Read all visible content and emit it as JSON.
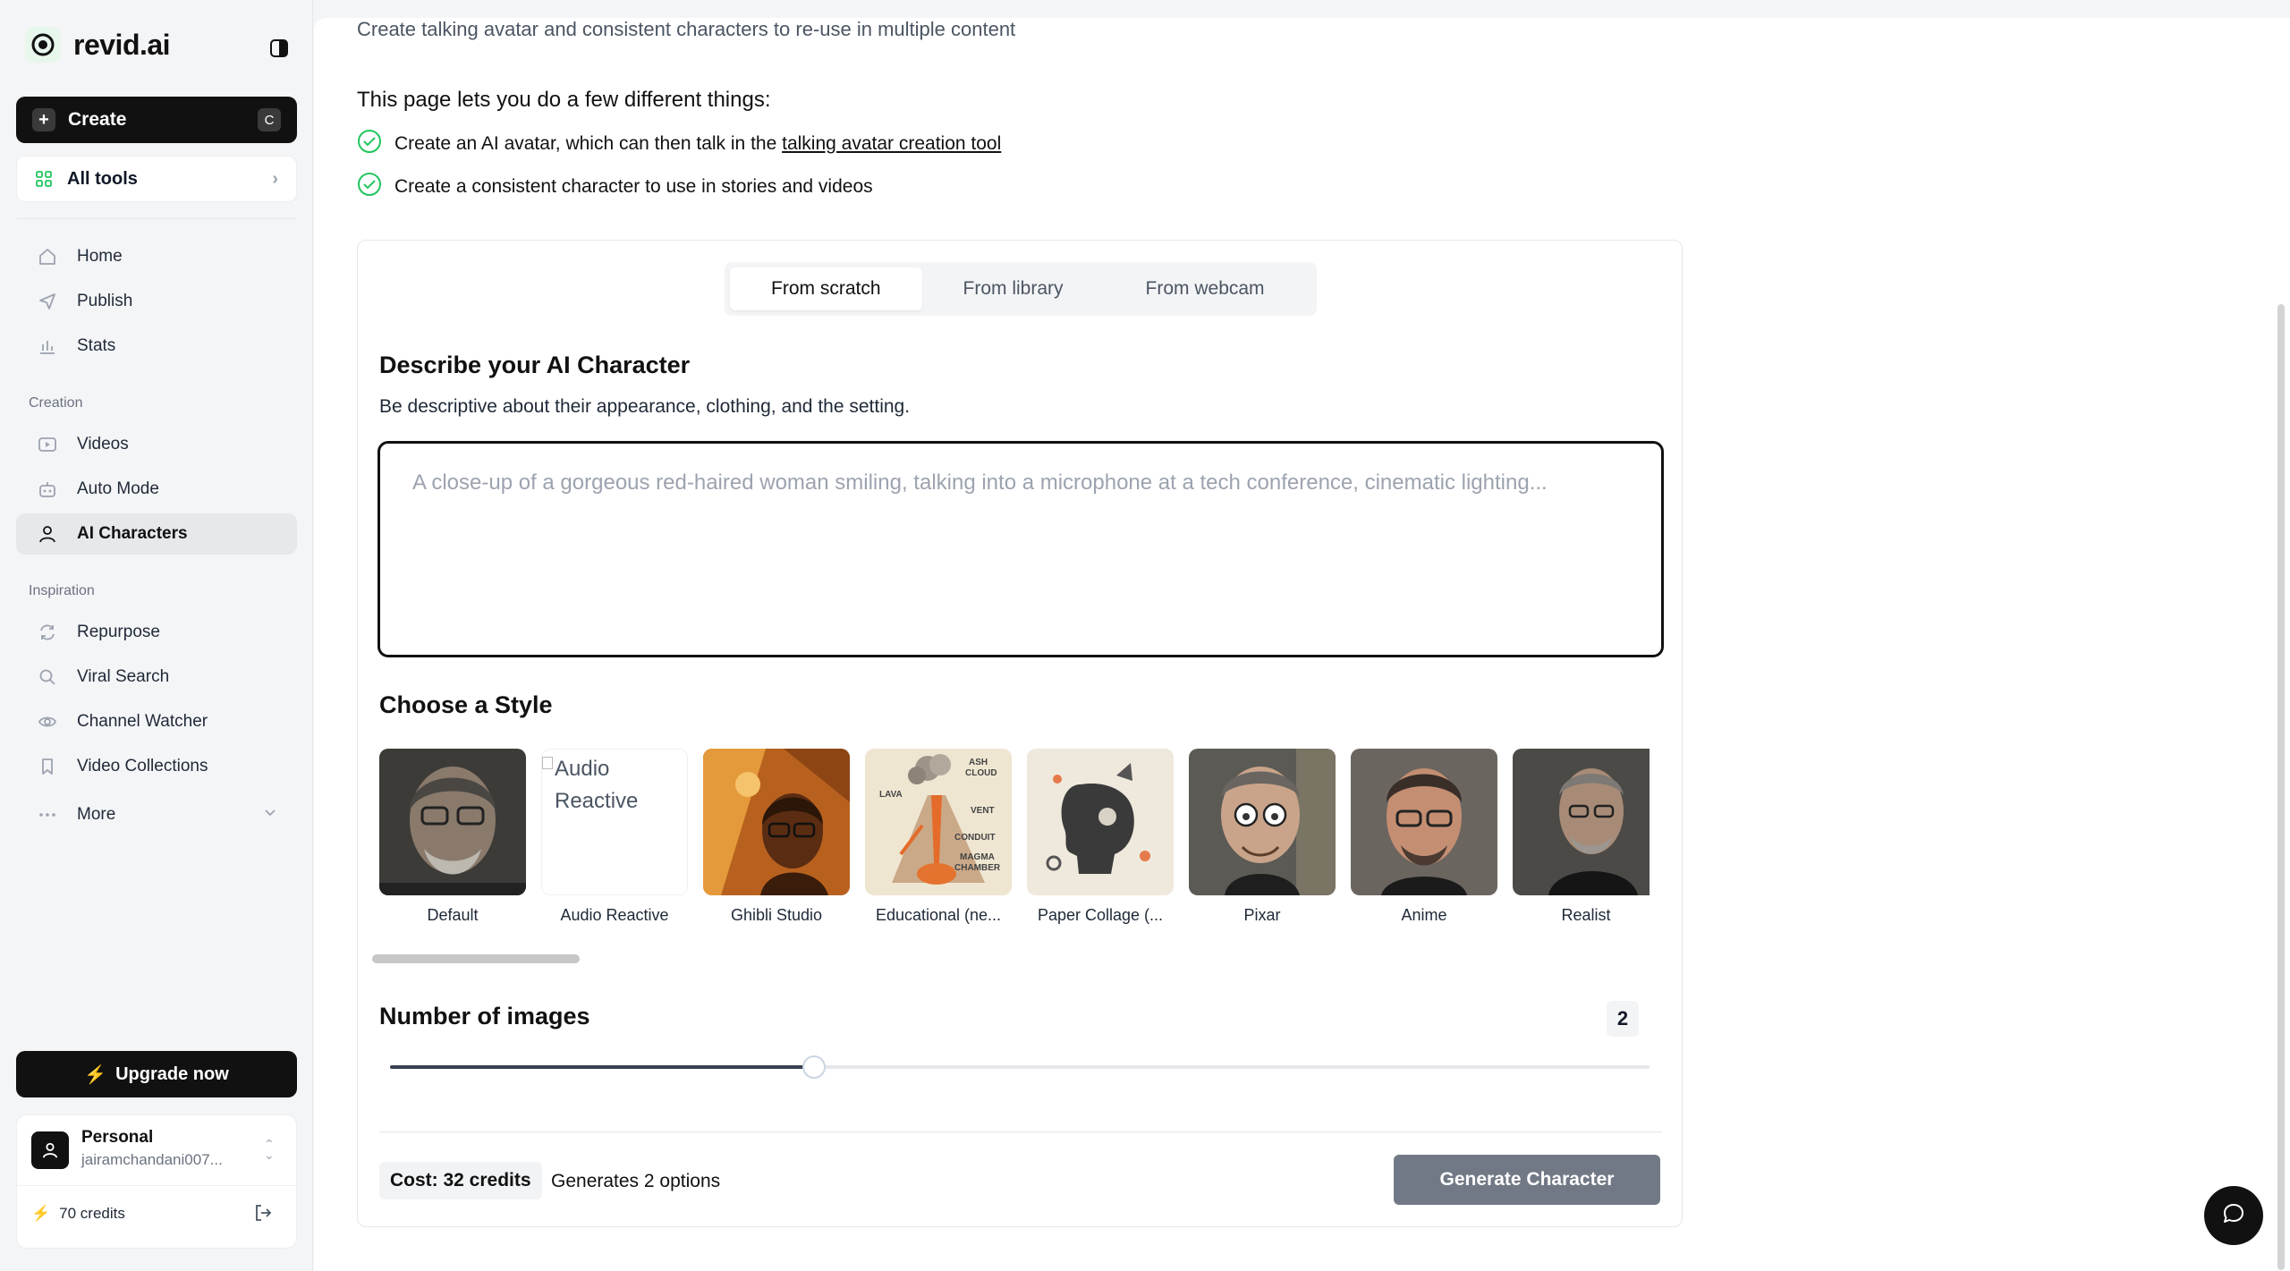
{
  "brand": {
    "name": "revid.ai"
  },
  "sidebar": {
    "create": {
      "label": "Create",
      "shortcut": "C"
    },
    "all_tools": {
      "label": "All tools"
    },
    "main_items": [
      {
        "label": "Home",
        "icon": "home-icon"
      },
      {
        "label": "Publish",
        "icon": "send-icon"
      },
      {
        "label": "Stats",
        "icon": "bar-chart-icon"
      }
    ],
    "creation_label": "Creation",
    "creation_items": [
      {
        "label": "Videos",
        "icon": "video-icon"
      },
      {
        "label": "Auto Mode",
        "icon": "robot-icon"
      },
      {
        "label": "AI Characters",
        "icon": "user-icon",
        "active": true
      }
    ],
    "inspiration_label": "Inspiration",
    "inspiration_items": [
      {
        "label": "Repurpose",
        "icon": "refresh-icon"
      },
      {
        "label": "Viral Search",
        "icon": "search-icon"
      },
      {
        "label": "Channel Watcher",
        "icon": "eye-icon"
      },
      {
        "label": "Video Collections",
        "icon": "bookmark-icon"
      },
      {
        "label": "More",
        "icon": "more-icon"
      }
    ],
    "upgrade": {
      "label": "Upgrade now"
    },
    "account": {
      "name": "Personal",
      "email": "jairamchandani007...",
      "credits": "70 credits"
    }
  },
  "main": {
    "subtitle": "Create talking avatar and consistent characters to re-use in multiple content",
    "intro": "This page lets you do a few different things:",
    "bullet1_prefix": "Create an AI avatar, which can then talk in the ",
    "bullet1_link": "talking avatar creation tool",
    "bullet2": "Create a consistent character to use in stories and videos",
    "tabs": [
      {
        "label": "From scratch",
        "active": true
      },
      {
        "label": "From library"
      },
      {
        "label": "From webcam"
      }
    ],
    "describe_title": "Describe your AI Character",
    "describe_hint": "Be descriptive about their appearance, clothing, and the setting.",
    "prompt_placeholder": "A close-up of a gorgeous red-haired woman smiling, talking into a microphone at a tech conference, cinematic lighting...",
    "style_title": "Choose a Style",
    "styles": [
      {
        "label": "Default"
      },
      {
        "label": "Audio Reactive",
        "broken_image_alt": "Audio Reactive"
      },
      {
        "label": "Ghibli Studio"
      },
      {
        "label": "Educational (ne..."
      },
      {
        "label": "Paper Collage (..."
      },
      {
        "label": "Pixar"
      },
      {
        "label": "Anime"
      },
      {
        "label": "Realist"
      }
    ],
    "educational_labels": {
      "ash": "ASH",
      "cloud": "CLOUD",
      "lava": "LAVA",
      "vent": "VENT",
      "conduit": "CONDUIT",
      "magma": "MAGMA",
      "chamber": "CHAMBER"
    },
    "images_title": "Number of images",
    "images_count": "2",
    "slider_fraction": 0.337,
    "cost": "Cost: 32 credits",
    "generates": "Generates 2 options",
    "generate_button": "Generate Character"
  },
  "colors": {
    "accent_green": "#22c55e",
    "dark": "#111111",
    "disabled_button": "#6b7280"
  }
}
